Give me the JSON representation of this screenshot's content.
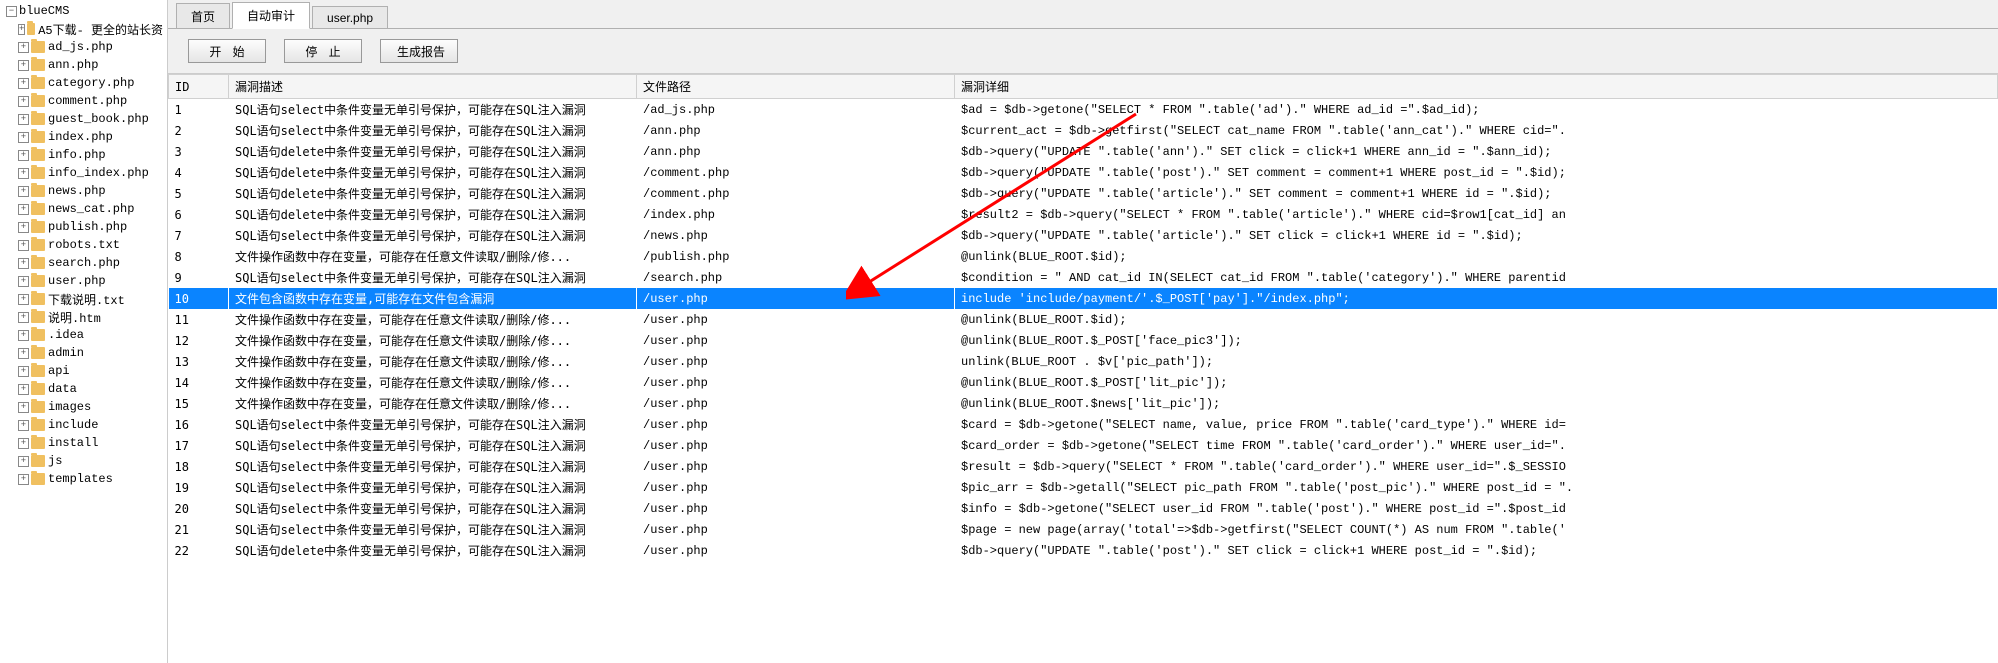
{
  "sidebar": {
    "root": "blueCMS",
    "items": [
      {
        "label": "A5下载- 更全的站长资"
      },
      {
        "label": "ad_js.php"
      },
      {
        "label": "ann.php"
      },
      {
        "label": "category.php"
      },
      {
        "label": "comment.php"
      },
      {
        "label": "guest_book.php"
      },
      {
        "label": "index.php"
      },
      {
        "label": "info.php"
      },
      {
        "label": "info_index.php"
      },
      {
        "label": "news.php"
      },
      {
        "label": "news_cat.php"
      },
      {
        "label": "publish.php"
      },
      {
        "label": "robots.txt"
      },
      {
        "label": "search.php"
      },
      {
        "label": "user.php"
      },
      {
        "label": "下载说明.txt"
      },
      {
        "label": "说明.htm"
      },
      {
        "label": ".idea"
      },
      {
        "label": "admin"
      },
      {
        "label": "api"
      },
      {
        "label": "data"
      },
      {
        "label": "images"
      },
      {
        "label": "include"
      },
      {
        "label": "install"
      },
      {
        "label": "js"
      },
      {
        "label": "templates"
      }
    ]
  },
  "tabs": [
    {
      "label": "首页"
    },
    {
      "label": "自动审计",
      "active": true
    },
    {
      "label": "user.php"
    }
  ],
  "toolbar": {
    "start": "开 始",
    "stop": "停 止",
    "report": "生成报告"
  },
  "grid": {
    "headers": {
      "id": "ID",
      "desc": "漏洞描述",
      "path": "文件路径",
      "detail": "漏洞详细"
    },
    "rows": [
      {
        "id": "1",
        "desc": "SQL语句select中条件变量无单引号保护，可能存在SQL注入漏洞",
        "path": "/ad_js.php",
        "detail": "$ad = $db->getone(\"SELECT * FROM \".table('ad').\" WHERE ad_id =\".$ad_id);"
      },
      {
        "id": "2",
        "desc": "SQL语句select中条件变量无单引号保护，可能存在SQL注入漏洞",
        "path": "/ann.php",
        "detail": "$current_act = $db->getfirst(\"SELECT cat_name FROM \".table('ann_cat').\" WHERE cid=\"."
      },
      {
        "id": "3",
        "desc": "SQL语句delete中条件变量无单引号保护，可能存在SQL注入漏洞",
        "path": "/ann.php",
        "detail": "$db->query(\"UPDATE \".table('ann').\" SET click = click+1 WHERE ann_id = \".$ann_id);"
      },
      {
        "id": "4",
        "desc": "SQL语句delete中条件变量无单引号保护，可能存在SQL注入漏洞",
        "path": "/comment.php",
        "detail": "$db->query(\"UPDATE \".table('post').\" SET comment = comment+1 WHERE post_id = \".$id);"
      },
      {
        "id": "5",
        "desc": "SQL语句delete中条件变量无单引号保护，可能存在SQL注入漏洞",
        "path": "/comment.php",
        "detail": "$db->query(\"UPDATE \".table('article').\" SET comment = comment+1 WHERE id = \".$id);"
      },
      {
        "id": "6",
        "desc": "SQL语句delete中条件变量无单引号保护，可能存在SQL注入漏洞",
        "path": "/index.php",
        "detail": "$result2 = $db->query(\"SELECT * FROM \".table('article').\" WHERE cid=$row1[cat_id] an"
      },
      {
        "id": "7",
        "desc": "SQL语句select中条件变量无单引号保护，可能存在SQL注入漏洞",
        "path": "/news.php",
        "detail": "$db->query(\"UPDATE \".table('article').\" SET click = click+1 WHERE id = \".$id);"
      },
      {
        "id": "8",
        "desc": "文件操作函数中存在变量，可能存在任意文件读取/删除/修...",
        "path": "/publish.php",
        "detail": "@unlink(BLUE_ROOT.$id);"
      },
      {
        "id": "9",
        "desc": "SQL语句select中条件变量无单引号保护，可能存在SQL注入漏洞",
        "path": "/search.php",
        "detail": "$condition = \" AND cat_id IN(SELECT cat_id FROM \".table('category').\" WHERE parentid"
      },
      {
        "id": "10",
        "desc": "文件包含函数中存在变量,可能存在文件包含漏洞",
        "path": "/user.php",
        "detail": "include 'include/payment/'.$_POST['pay'].\"/index.php\";",
        "selected": true
      },
      {
        "id": "11",
        "desc": "文件操作函数中存在变量，可能存在任意文件读取/删除/修...",
        "path": "/user.php",
        "detail": "@unlink(BLUE_ROOT.$id);"
      },
      {
        "id": "12",
        "desc": "文件操作函数中存在变量，可能存在任意文件读取/删除/修...",
        "path": "/user.php",
        "detail": "@unlink(BLUE_ROOT.$_POST['face_pic3']);"
      },
      {
        "id": "13",
        "desc": "文件操作函数中存在变量，可能存在任意文件读取/删除/修...",
        "path": "/user.php",
        "detail": "unlink(BLUE_ROOT . $v['pic_path']);"
      },
      {
        "id": "14",
        "desc": "文件操作函数中存在变量，可能存在任意文件读取/删除/修...",
        "path": "/user.php",
        "detail": "@unlink(BLUE_ROOT.$_POST['lit_pic']);"
      },
      {
        "id": "15",
        "desc": "文件操作函数中存在变量，可能存在任意文件读取/删除/修...",
        "path": "/user.php",
        "detail": "@unlink(BLUE_ROOT.$news['lit_pic']);"
      },
      {
        "id": "16",
        "desc": "SQL语句select中条件变量无单引号保护，可能存在SQL注入漏洞",
        "path": "/user.php",
        "detail": "$card = $db->getone(\"SELECT name, value, price FROM \".table('card_type').\" WHERE id="
      },
      {
        "id": "17",
        "desc": "SQL语句select中条件变量无单引号保护，可能存在SQL注入漏洞",
        "path": "/user.php",
        "detail": "$card_order = $db->getone(\"SELECT time FROM \".table('card_order').\" WHERE user_id=\"."
      },
      {
        "id": "18",
        "desc": "SQL语句select中条件变量无单引号保护，可能存在SQL注入漏洞",
        "path": "/user.php",
        "detail": "$result = $db->query(\"SELECT * FROM \".table('card_order').\" WHERE user_id=\".$_SESSIO"
      },
      {
        "id": "19",
        "desc": "SQL语句select中条件变量无单引号保护，可能存在SQL注入漏洞",
        "path": "/user.php",
        "detail": "$pic_arr = $db->getall(\"SELECT pic_path FROM \".table('post_pic').\" WHERE post_id = \"."
      },
      {
        "id": "20",
        "desc": "SQL语句select中条件变量无单引号保护，可能存在SQL注入漏洞",
        "path": "/user.php",
        "detail": "$info = $db->getone(\"SELECT user_id FROM \".table('post').\" WHERE post_id =\".$post_id"
      },
      {
        "id": "21",
        "desc": "SQL语句select中条件变量无单引号保护，可能存在SQL注入漏洞",
        "path": "/user.php",
        "detail": "$page = new page(array('total'=>$db->getfirst(\"SELECT COUNT(*) AS num FROM \".table('"
      },
      {
        "id": "22",
        "desc": "SQL语句delete中条件变量无单引号保护，可能存在SQL注入漏洞",
        "path": "/user.php",
        "detail": "$db->query(\"UPDATE \".table('post').\" SET click = click+1 WHERE post_id = \".$id);"
      }
    ]
  }
}
